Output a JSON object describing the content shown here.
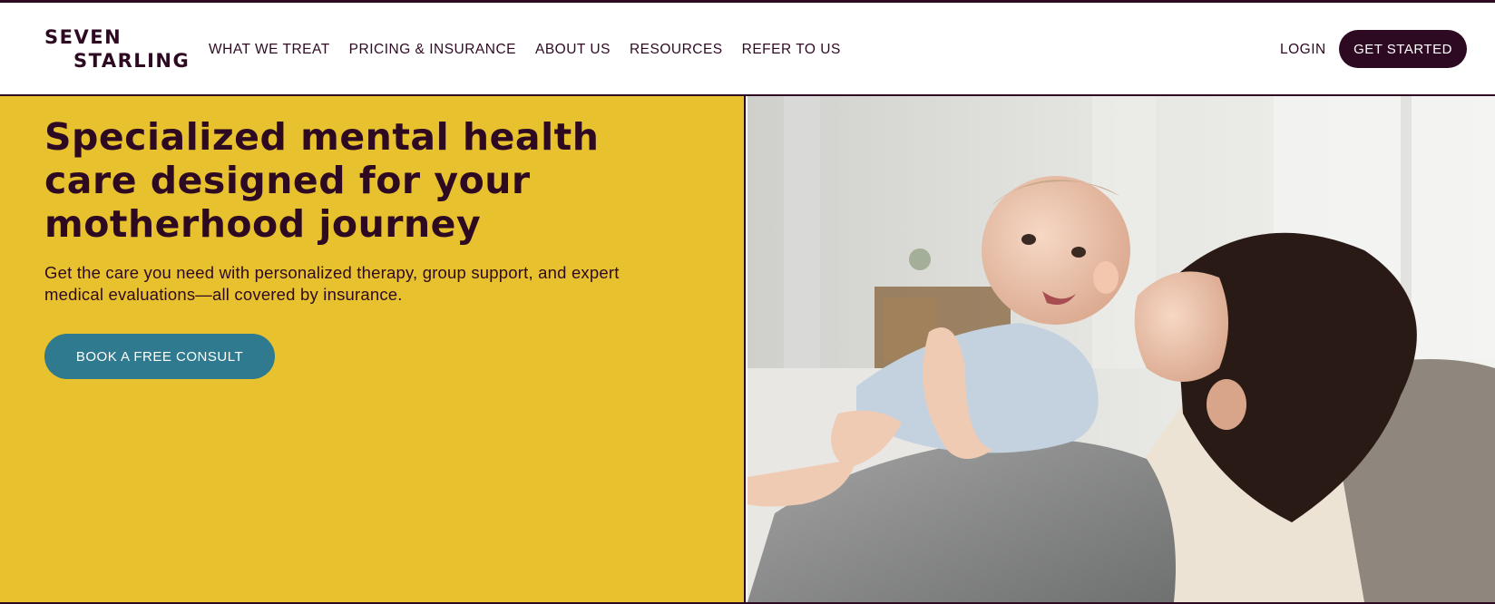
{
  "brand": {
    "line1": "SEVEN",
    "line2": "STARLING"
  },
  "nav": {
    "items": [
      {
        "label": "WHAT WE TREAT"
      },
      {
        "label": "PRICING & INSURANCE"
      },
      {
        "label": "ABOUT US"
      },
      {
        "label": "RESOURCES"
      },
      {
        "label": "REFER TO US"
      }
    ],
    "login_label": "LOGIN",
    "get_started_label": "GET STARTED"
  },
  "hero": {
    "headline": "Specialized mental health care designed for your motherhood journey",
    "subtext": "Get the care you need with personalized therapy, group support, and expert medical evaluations—all covered by insurance.",
    "cta_label": "BOOK A FREE CONSULT",
    "image": "mother-kissing-baby-photo"
  },
  "colors": {
    "brand_dark": "#2d0a22",
    "hero_yellow": "#e8c12e",
    "cta_teal": "#2f7a8e"
  }
}
